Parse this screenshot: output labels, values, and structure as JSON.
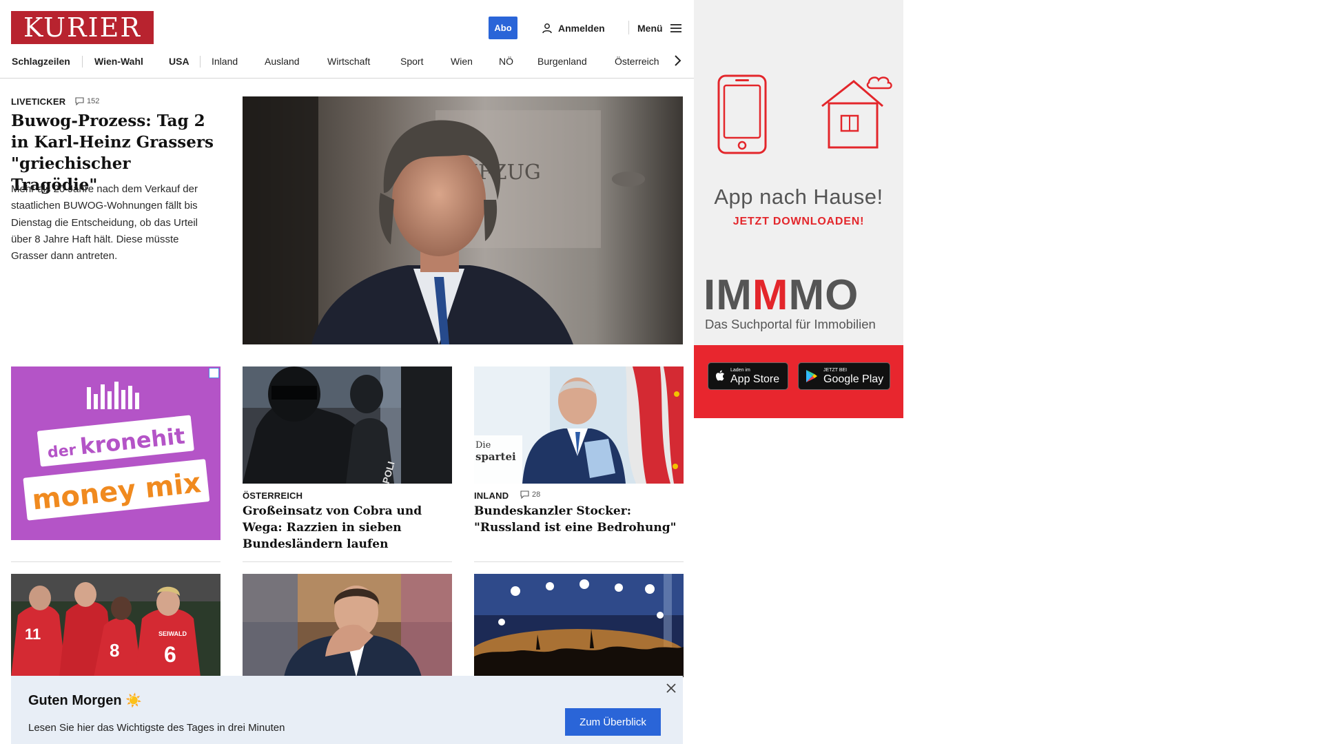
{
  "header": {
    "logo": "KURIER",
    "abo": "Abo",
    "login": "Anmelden",
    "menu": "Menü"
  },
  "nav": {
    "items": [
      "Schlagzeilen",
      "Wien-Wahl",
      "USA",
      "Inland",
      "Ausland",
      "Wirtschaft",
      "Sport",
      "Wien",
      "NÖ",
      "Burgenland",
      "Österreich"
    ]
  },
  "lead": {
    "kicker": "LIVETICKER",
    "comments": "152",
    "title": "Buwog-Prozess: Tag 2 in Karl-Heinz Grassers \"griechischer Tragödie\"",
    "text": "Mehr als 20 Jahre nach dem Verkauf der staatlichen BUWOG-Wohnungen fällt bis Dienstag die Entscheidung, ob das Urteil über 8 Jahre Haft hält. Diese müsste Grasser dann antreten.",
    "image_sign": "AUFZUG"
  },
  "ad_left": {
    "line1": "der",
    "line2": "kronehit",
    "line3": "money mix"
  },
  "cards": [
    {
      "kicker": "ÖSTERREICH",
      "title": "Großeinsatz von Cobra und Wega: Razzien in sieben Bundesländern laufen",
      "image_text": "POLI"
    },
    {
      "kicker": "INLAND",
      "comments": "28",
      "title": "Bundeskanzler Stocker: \"Russland ist eine Bedrohung\"",
      "image_text_1": "Die",
      "image_text_2": "spartei"
    }
  ],
  "row3_images": {
    "sport_jersey_1": "SEIWALD",
    "sport_jersey_number_1": "6",
    "sport_jersey_number_2": "11",
    "sport_jersey_number_3": "8"
  },
  "notification": {
    "title": "Guten Morgen",
    "title_emoji": "☀️",
    "text": "Lesen Sie hier das Wichtigste des Tages in drei Minuten",
    "button": "Zum Überblick"
  },
  "right_ad": {
    "headline": "App nach Hause!",
    "cta": "JETZT DOWNLOADEN!",
    "brand_gray_1": "IM",
    "brand_red": "M",
    "brand_gray_2": "MO",
    "tagline": "Das Suchportal für Immobilien",
    "appstore_small": "Laden im",
    "appstore_big": "App Store",
    "googleplay_small": "JETZT BEI",
    "googleplay_big": "Google Play"
  },
  "colors": {
    "brand_red": "#b8232f",
    "accent_blue": "#2a65d8",
    "ad_red": "#e8262e",
    "ad_purple": "#b454c7"
  }
}
